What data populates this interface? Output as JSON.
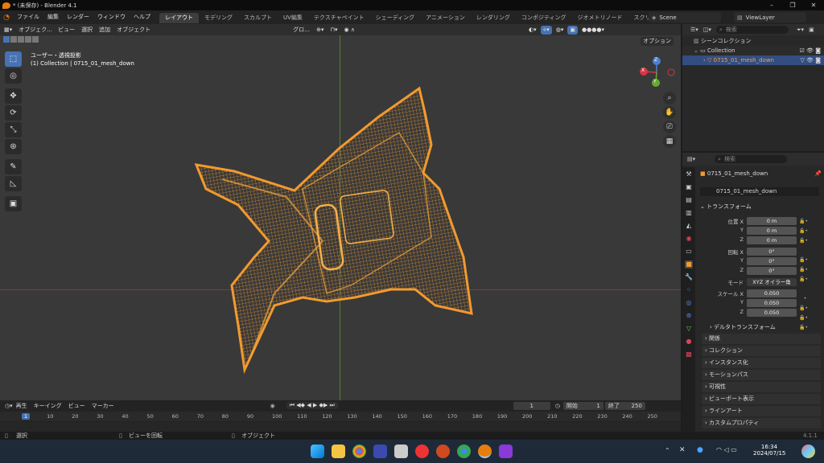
{
  "window": {
    "title": "* (未保存) - Blender 4.1"
  },
  "menus": [
    "ファイル",
    "編集",
    "レンダー",
    "ウィンドウ",
    "ヘルプ"
  ],
  "workspaces": [
    "レイアウト",
    "モデリング",
    "スカルプト",
    "UV編集",
    "テクスチャペイント",
    "シェーディング",
    "アニメーション",
    "レンダリング",
    "コンポジティング",
    "ジオメトリノード",
    "スクリプト作成"
  ],
  "active_workspace": "レイアウト",
  "scene": "Scene",
  "view_layer": "ViewLayer",
  "viewport": {
    "mode": "オブジェク…",
    "menus": [
      "ビュー",
      "選択",
      "追加",
      "オブジェクト"
    ],
    "transform_orientation": "グロ…",
    "options_label": "オプション",
    "view_name": "ユーザー・透視投影",
    "collection_info": "(1) Collection | 0715_01_mesh_down",
    "gizmo": {
      "x": "X",
      "y": "Y",
      "z": "Z"
    }
  },
  "outliner": {
    "search_placeholder": "検索",
    "root": "シーンコレクション",
    "collection": "Collection",
    "object": "0715_01_mesh_down"
  },
  "properties": {
    "search_placeholder": "検索",
    "object_name": "0715_01_mesh_down",
    "data_name": "0715_01_mesh_down",
    "transform_header": "トランスフォーム",
    "location_label": "位置 X",
    "rotation_label": "回転 X",
    "scale_label": "スケール X",
    "mode_label": "モード",
    "mode_value": "XYZ オイラー角",
    "axis_y": "Y",
    "axis_z": "Z",
    "location": [
      "0 m",
      "0 m",
      "0 m"
    ],
    "rotation": [
      "0°",
      "0°",
      "0°"
    ],
    "scale": [
      "0.050",
      "0.050",
      "0.050"
    ],
    "sections": [
      "デルタトランスフォーム",
      "関係",
      "コレクション",
      "インスタンス化",
      "モーションパス",
      "可視性",
      "ビューポート表示",
      "ラインアート",
      "カスタムプロパティ"
    ]
  },
  "timeline": {
    "menus": [
      "再生",
      "キーイング",
      "ビュー",
      "マーカー"
    ],
    "current_frame": "1",
    "start_label": "開始",
    "start": "1",
    "end_label": "終了",
    "end": "250",
    "ruler": [
      "1",
      "10",
      "20",
      "30",
      "40",
      "50",
      "60",
      "70",
      "80",
      "90",
      "100",
      "110",
      "120",
      "130",
      "140",
      "150",
      "160",
      "170",
      "180",
      "190",
      "200",
      "210",
      "220",
      "230",
      "240",
      "250"
    ]
  },
  "statusbar": {
    "select": "選択",
    "rotate": "ビューを回転",
    "object": "オブジェクト",
    "version": "4.1.1"
  },
  "taskbar": {
    "time": "16:34",
    "date": "2024/07/15"
  },
  "colors": {
    "accent": "#4772b3",
    "mesh": "#f29a2e",
    "active_tab": "#3d3d3d"
  }
}
